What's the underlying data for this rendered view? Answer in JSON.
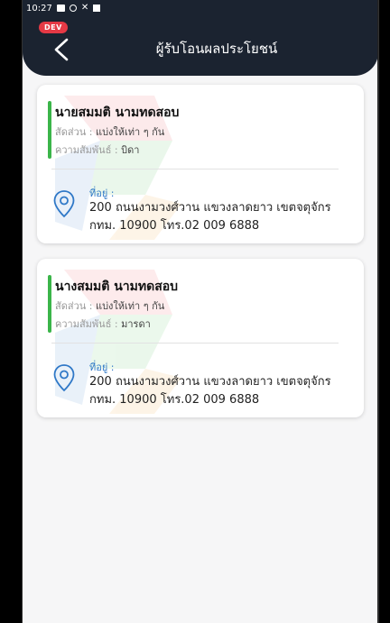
{
  "status_bar": {
    "time": "10:27"
  },
  "header": {
    "env_badge": "DEV",
    "title": "ผู้รับโอนผลประโยชน์"
  },
  "colors": {
    "header_bg": "#1b2330",
    "accent": "#3bb54a",
    "badge": "#e53945",
    "link": "#2f78c7"
  },
  "beneficiaries": [
    {
      "name": "นายสมมติ นามทดสอบ",
      "share_label": "สัดส่วน :",
      "share_value": "แบ่งให้เท่า ๆ กัน",
      "relation_label": "ความสัมพันธ์ :",
      "relation_value": "บิดา",
      "address_label": "ที่อยู่ :",
      "address": "200 ถนนงามวงศ์วาน แขวงลาดยาว เขตจตุจักร กทม. 10900 โทร.02 009 6888"
    },
    {
      "name": "นางสมมติ นามทดสอบ",
      "share_label": "สัดส่วน :",
      "share_value": "แบ่งให้เท่า ๆ กัน",
      "relation_label": "ความสัมพันธ์ :",
      "relation_value": "มารดา",
      "address_label": "ที่อยู่ :",
      "address": "200 ถนนงามวงศ์วาน แขวงลาดยาว เขตจตุจักร กทม. 10900 โทร.02 009 6888"
    }
  ]
}
